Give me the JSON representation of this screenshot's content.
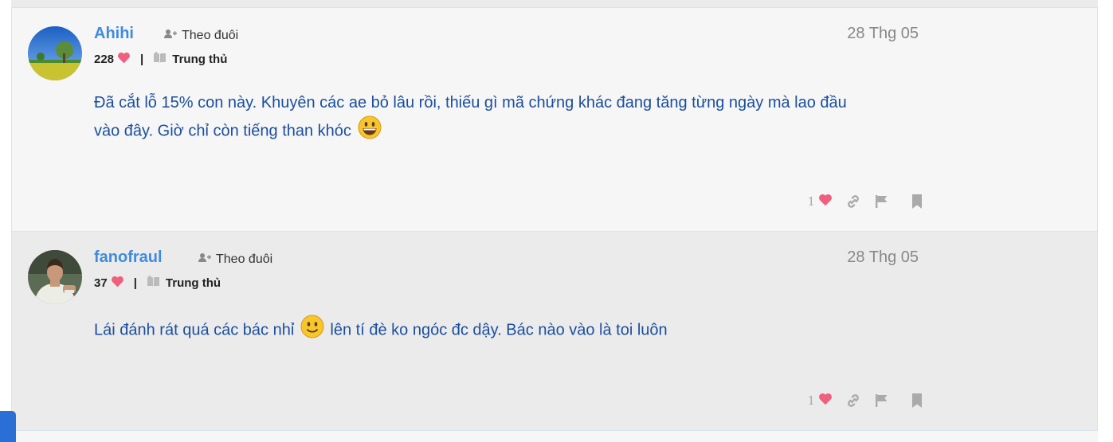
{
  "posts": [
    {
      "username": "Ahihi",
      "follow_label": "Theo đuôi",
      "date": "28 Thg 05",
      "score": "228",
      "rank": "Trung thủ",
      "content_1": "Đã cắt lỗ 15% con này. Khuyên các ae bỏ lâu rồi, thiếu gì mã chứng khác đang tăng từng ngày mà lao đầu",
      "content_2": "vào đây. Giờ chỉ còn tiếng than khóc",
      "emoji": "grinning-face-emoji",
      "likes": "1"
    },
    {
      "username": "fanofraul",
      "follow_label": "Theo đuôi",
      "date": "28 Thg 05",
      "score": "37",
      "rank": "Trung thủ",
      "content_1": "Lái đánh rát quá các bác nhỉ",
      "content_2": "lên tí đè ko ngóc đc dậy. Bác nào vào là toi luôn",
      "emoji": "slightly-smiling-face-emoji",
      "likes": "1"
    }
  ],
  "icons": {
    "heart": "heart-icon",
    "follow": "user-plus-icon",
    "rank": "book-icon",
    "link": "link-icon",
    "flag": "flag-icon",
    "bookmark": "bookmark-icon"
  },
  "colors": {
    "username": "#3f8be0",
    "content": "#1a4e9e",
    "heart": "#f0607e",
    "accent_tab": "#2a6fd6"
  }
}
